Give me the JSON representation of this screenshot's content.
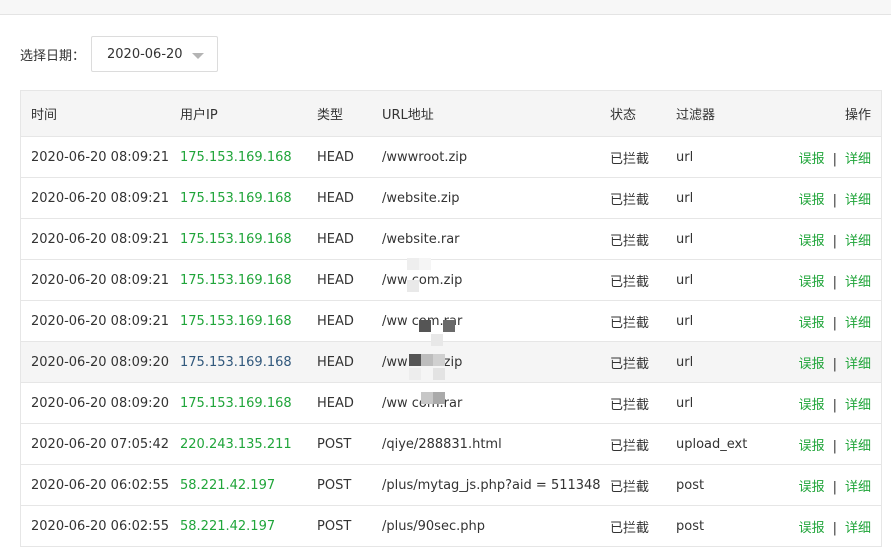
{
  "filter": {
    "label": "选择日期：",
    "date_value": "2020-06-20"
  },
  "table": {
    "headers": {
      "time": "时间",
      "ip": "用户IP",
      "type": "类型",
      "url": "URL地址",
      "status": "状态",
      "filter": "过滤器",
      "ops": "操作"
    },
    "op_labels": {
      "report": "误报",
      "separator": "|",
      "detail": "详细"
    },
    "rows": [
      {
        "time": "2020-06-20 08:09:21",
        "ip": "175.153.169.168",
        "type": "HEAD",
        "url": "/wwwroot.zip",
        "status": "已拦截",
        "filter": "url"
      },
      {
        "time": "2020-06-20 08:09:21",
        "ip": "175.153.169.168",
        "type": "HEAD",
        "url": "/website.zip",
        "status": "已拦截",
        "filter": "url"
      },
      {
        "time": "2020-06-20 08:09:21",
        "ip": "175.153.169.168",
        "type": "HEAD",
        "url": "/website.rar",
        "status": "已拦截",
        "filter": "url"
      },
      {
        "time": "2020-06-20 08:09:21",
        "ip": "175.153.169.168",
        "type": "HEAD",
        "url": "/ww        com.zip",
        "status": "已拦截",
        "filter": "url"
      },
      {
        "time": "2020-06-20 08:09:21",
        "ip": "175.153.169.168",
        "type": "HEAD",
        "url": "/ww        com.rar",
        "status": "已拦截",
        "filter": "url"
      },
      {
        "time": "2020-06-20 08:09:20",
        "ip": "175.153.169.168",
        "type": "HEAD",
        "url": "/ww        com.zip",
        "status": "已拦截",
        "filter": "url"
      },
      {
        "time": "2020-06-20 08:09:20",
        "ip": "175.153.169.168",
        "type": "HEAD",
        "url": "/ww        com.rar",
        "status": "已拦截",
        "filter": "url"
      },
      {
        "time": "2020-06-20 07:05:42",
        "ip": "220.243.135.211",
        "type": "POST",
        "url": "/qiye/288831.html",
        "status": "已拦截",
        "filter": "upload_ext"
      },
      {
        "time": "2020-06-20 06:02:55",
        "ip": "58.221.42.197",
        "type": "POST",
        "url": "/plus/mytag_js.php?aid = 511348",
        "status": "已拦截",
        "filter": "post"
      },
      {
        "time": "2020-06-20 06:02:55",
        "ip": "58.221.42.197",
        "type": "POST",
        "url": "/plus/90sec.php",
        "status": "已拦截",
        "filter": "post"
      }
    ]
  },
  "colors": {
    "link_green": "#20a53a",
    "hover_ip": "#31587c",
    "header_bg": "#f5f5f5"
  }
}
